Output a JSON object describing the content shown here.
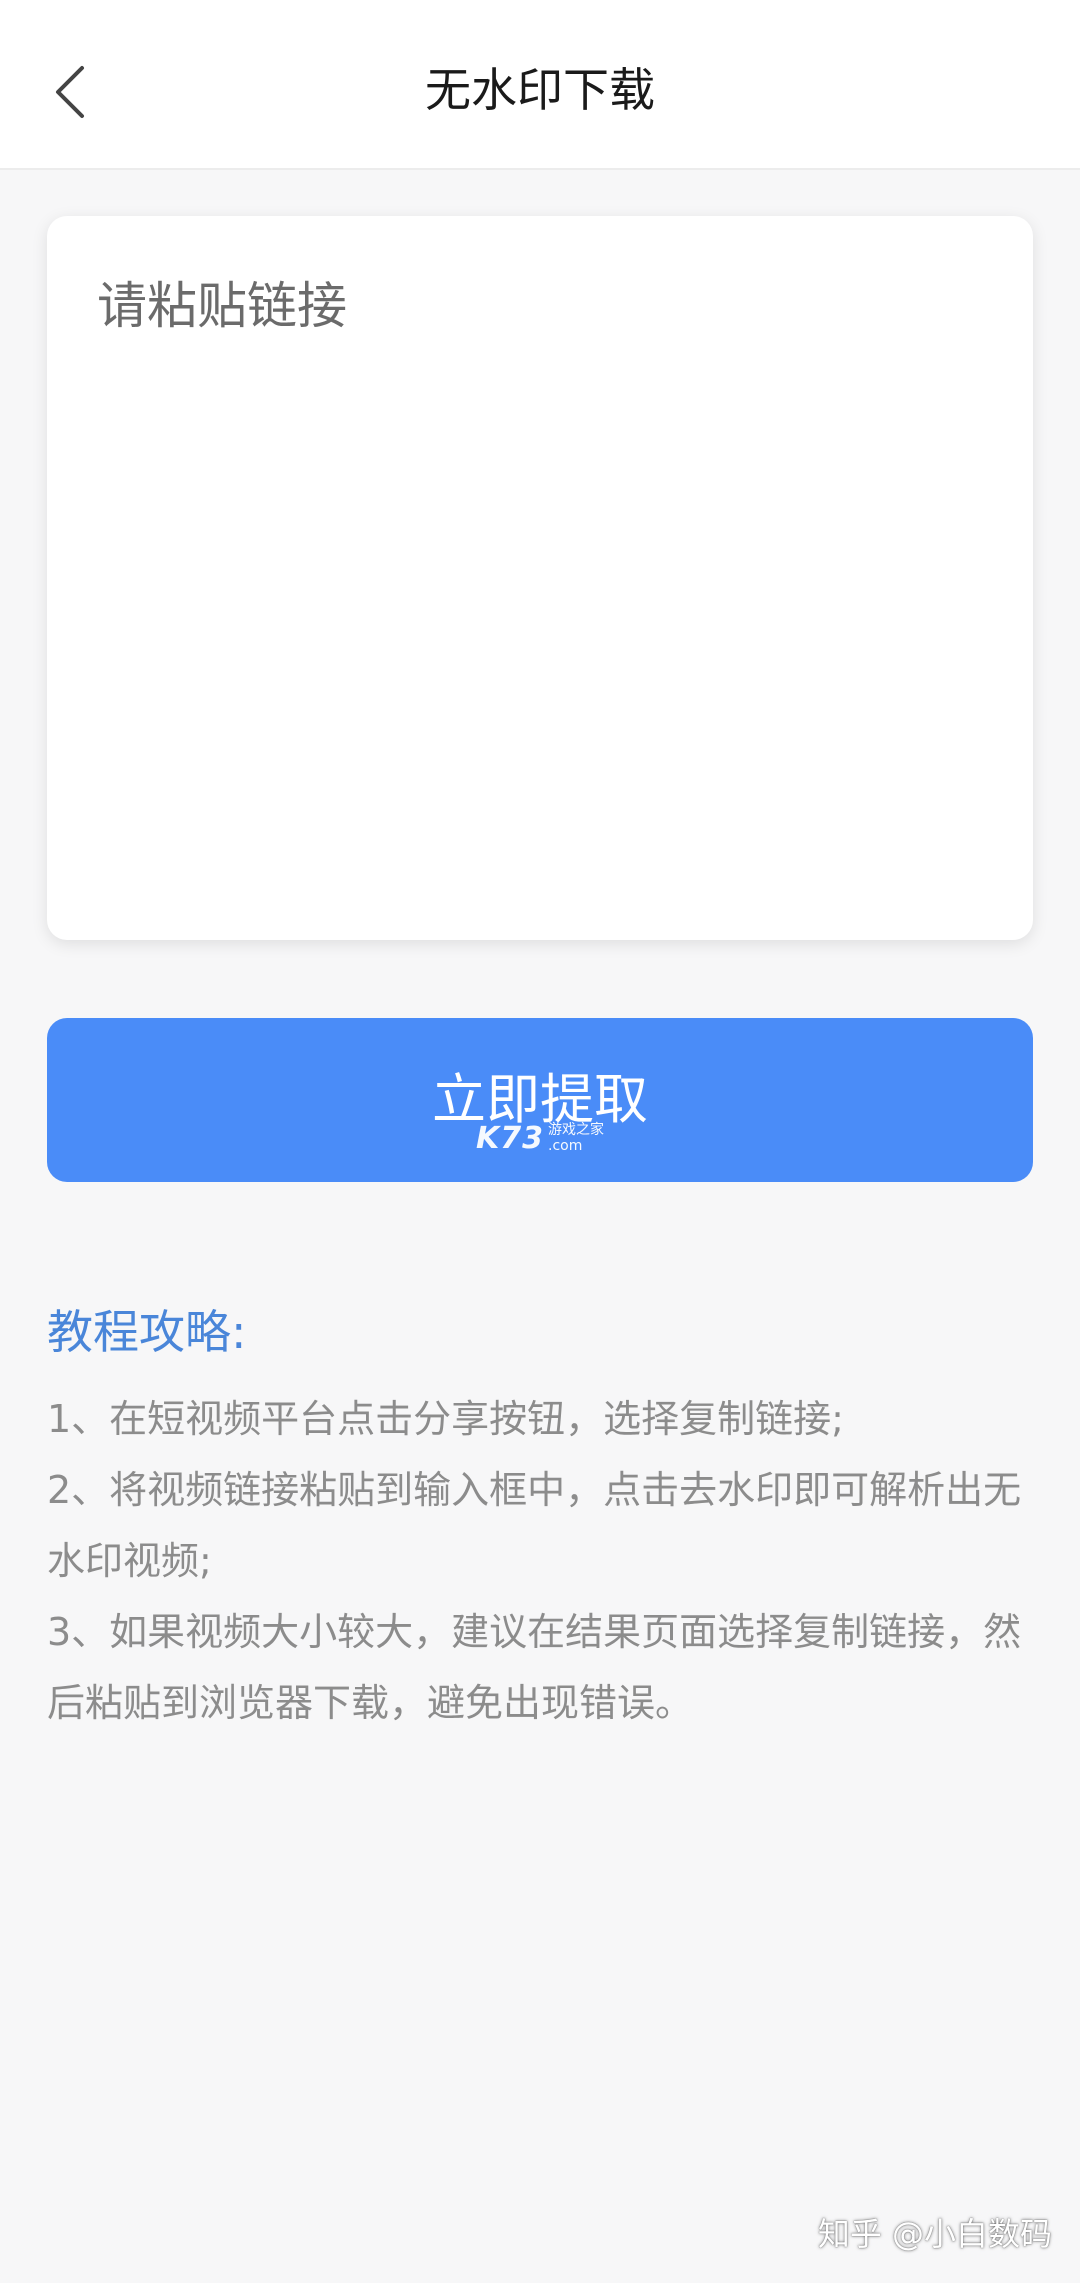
{
  "header": {
    "title": "无水印下载",
    "back_icon": "chevron-left-icon"
  },
  "input": {
    "placeholder": "请粘贴链接",
    "value": ""
  },
  "action": {
    "extract_label": "立即提取"
  },
  "image_watermark": {
    "logo": "K73",
    "subtitle_cn": "游戏之家",
    "subtitle_en": ".com"
  },
  "guide": {
    "title": "教程攻略:",
    "steps": [
      "1、在短视频平台点击分享按钮，选择复制链接;",
      "2、将视频链接粘贴到输入框中，点击去水印即可解析出无水印视频;",
      "3、如果视频大小较大，建议在结果页面选择复制链接，然后粘贴到浏览器下载，避免出现错误。"
    ]
  },
  "footer": {
    "watermark": "知乎 @小白数码"
  },
  "colors": {
    "accent": "#4a8cf8",
    "guide_title": "#4a86d9",
    "guide_text": "#8c8c8c",
    "background": "#f7f7f8"
  }
}
